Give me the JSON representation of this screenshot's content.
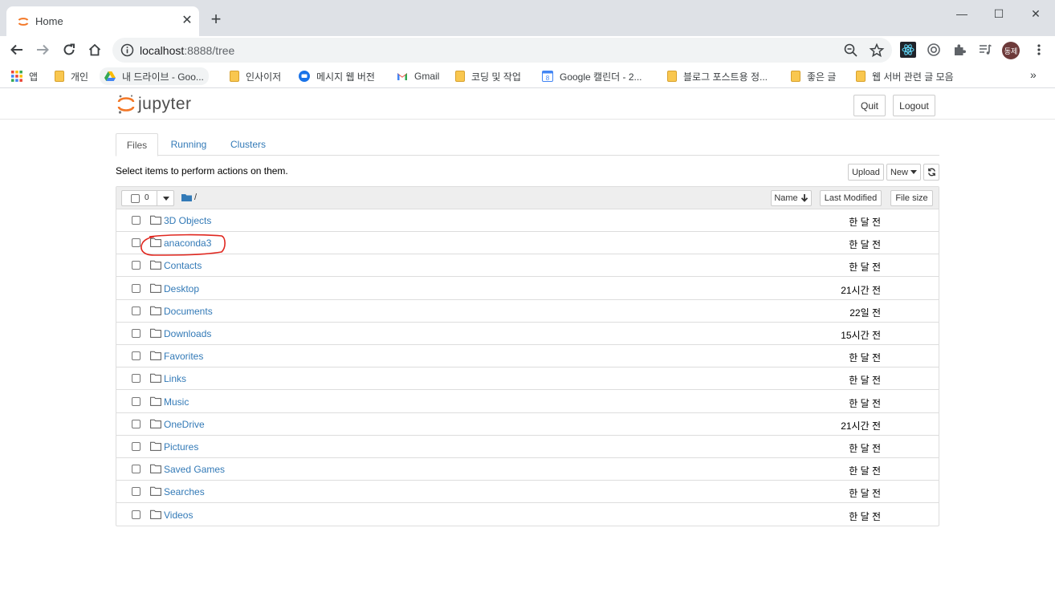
{
  "browser": {
    "tab_title": "Home",
    "url_host": "localhost",
    "url_port": ":8888",
    "url_path": "/tree",
    "profile_initials": "동제",
    "bookmarks": [
      {
        "label": "앱",
        "icon": "apps-grid-icon"
      },
      {
        "label": "개인",
        "icon": "folder-icon"
      },
      {
        "label": "내 드라이브 - Goo...",
        "icon": "google-drive-icon"
      },
      {
        "label": "인사이저",
        "icon": "folder-icon"
      },
      {
        "label": "메시지 웹 버전",
        "icon": "messages-icon"
      },
      {
        "label": "Gmail",
        "icon": "gmail-icon"
      },
      {
        "label": "코딩 및 작업",
        "icon": "folder-icon"
      },
      {
        "label": "Google 캘린더 - 2...",
        "icon": "calendar-icon"
      },
      {
        "label": "블로그 포스트용 정...",
        "icon": "folder-icon"
      },
      {
        "label": "좋은 글",
        "icon": "folder-icon"
      },
      {
        "label": "웹 서버 관련 글 모음",
        "icon": "folder-icon"
      }
    ],
    "bookmarks_more": "»"
  },
  "jupyter": {
    "logo_text": "jupyter",
    "quit_label": "Quit",
    "logout_label": "Logout",
    "tabs": [
      {
        "label": "Files",
        "active": true
      },
      {
        "label": "Running",
        "active": false
      },
      {
        "label": "Clusters",
        "active": false
      }
    ],
    "hint": "Select items to perform actions on them.",
    "upload_label": "Upload",
    "new_label": "New",
    "selected_count": "0",
    "breadcrumb_path": "/",
    "columns": {
      "name": "Name",
      "last_modified": "Last Modified",
      "file_size": "File size"
    },
    "files": [
      {
        "name": "3D Objects",
        "modified": "한 달 전"
      },
      {
        "name": "anaconda3",
        "modified": "한 달 전"
      },
      {
        "name": "Contacts",
        "modified": "한 달 전"
      },
      {
        "name": "Desktop",
        "modified": "21시간 전"
      },
      {
        "name": "Documents",
        "modified": "22일 전"
      },
      {
        "name": "Downloads",
        "modified": "15시간 전"
      },
      {
        "name": "Favorites",
        "modified": "한 달 전"
      },
      {
        "name": "Links",
        "modified": "한 달 전"
      },
      {
        "name": "Music",
        "modified": "한 달 전"
      },
      {
        "name": "OneDrive",
        "modified": "21시간 전"
      },
      {
        "name": "Pictures",
        "modified": "한 달 전"
      },
      {
        "name": "Saved Games",
        "modified": "한 달 전"
      },
      {
        "name": "Searches",
        "modified": "한 달 전"
      },
      {
        "name": "Videos",
        "modified": "한 달 전"
      }
    ],
    "annotation_color": "#e0271f",
    "link_color": "#337ab7"
  }
}
